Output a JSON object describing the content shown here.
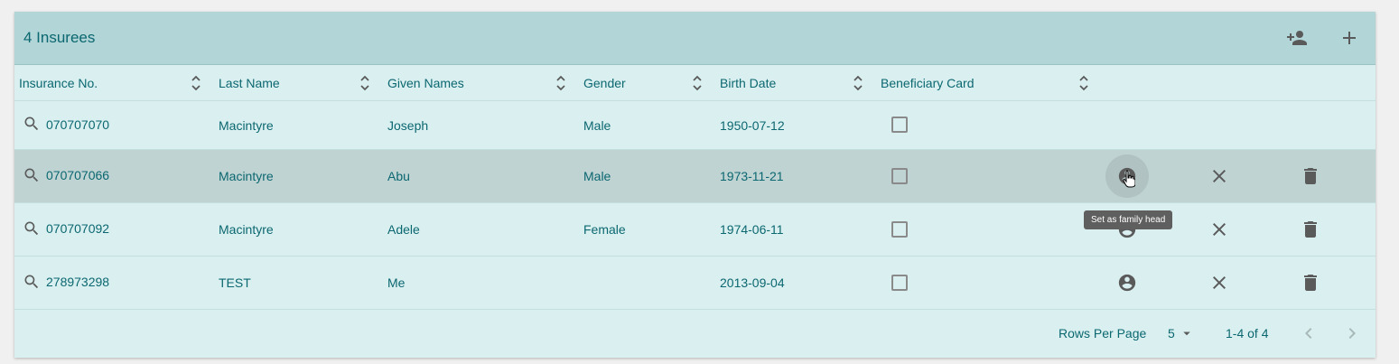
{
  "header": {
    "title": "4 Insurees",
    "icons": [
      "person-add-icon",
      "add-icon"
    ]
  },
  "columns": [
    {
      "label": "Insurance No."
    },
    {
      "label": "Last Name"
    },
    {
      "label": "Given Names"
    },
    {
      "label": "Gender"
    },
    {
      "label": "Birth Date"
    },
    {
      "label": "Beneficiary Card"
    }
  ],
  "rows": [
    {
      "insurance_no": "070707070",
      "last_name": "Macintyre",
      "given_names": "Joseph",
      "gender": "Male",
      "birth_date": "1950-07-12",
      "beneficiary_card": false
    },
    {
      "insurance_no": "070707066",
      "last_name": "Macintyre",
      "given_names": "Abu",
      "gender": "Male",
      "birth_date": "1973-11-21",
      "beneficiary_card": false
    },
    {
      "insurance_no": "070707092",
      "last_name": "Macintyre",
      "given_names": "Adele",
      "gender": "Female",
      "birth_date": "1974-06-11",
      "beneficiary_card": false
    },
    {
      "insurance_no": "278973298",
      "last_name": "TEST",
      "given_names": "Me",
      "gender": "",
      "birth_date": "2013-09-04",
      "beneficiary_card": false
    }
  ],
  "tooltip": "Set as family head",
  "footer": {
    "rows_per_page_label": "Rows Per Page",
    "rows_per_page_value": "5",
    "range": "1-4 of 4"
  },
  "colors": {
    "accent_text": "#0b6770",
    "header_bg": "#b2d6d7",
    "table_bg": "#daf0f0",
    "hover_row": "#bfd3d3",
    "icon": "#5a5a5a"
  }
}
